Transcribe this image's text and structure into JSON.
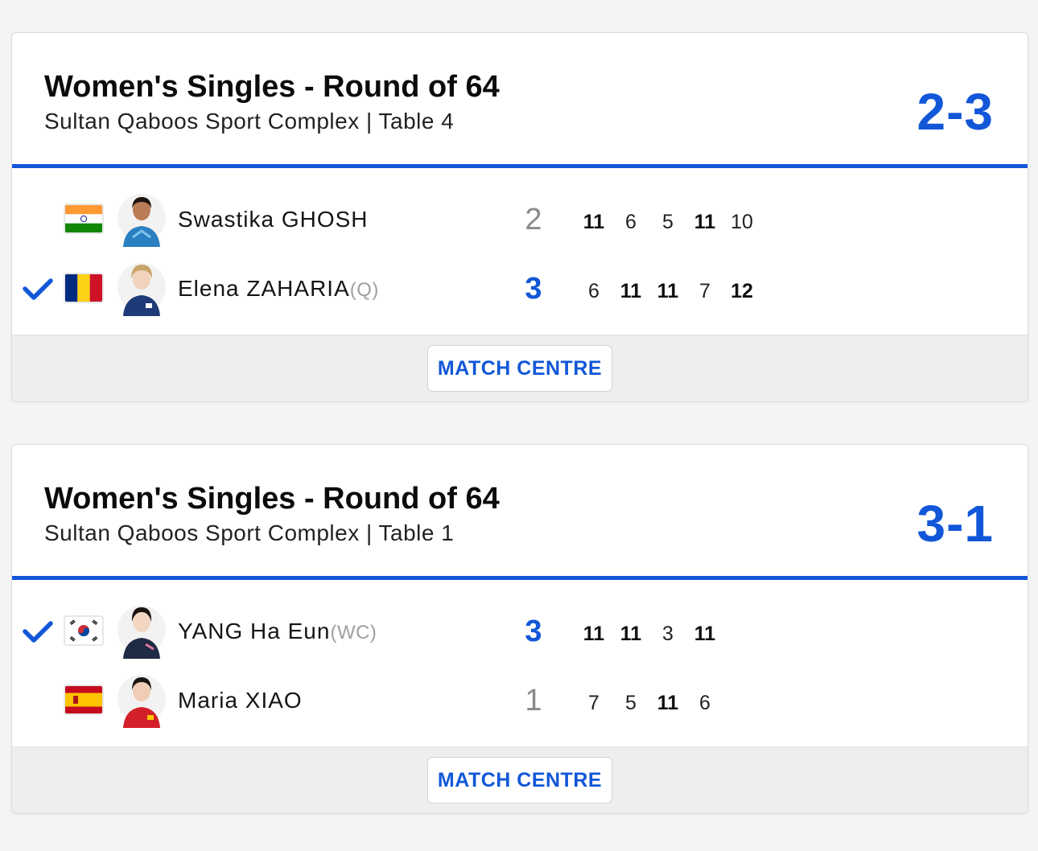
{
  "matches": [
    {
      "title": "Women's Singles - Round of 64",
      "venue": "Sultan Qaboos Sport Complex | Table 4",
      "score": "2-3",
      "button_label": "MATCH CENTRE",
      "players": [
        {
          "name": "Swastika GHOSH",
          "tag": "",
          "flag": "india-flag",
          "winner": false,
          "sets": "2",
          "games": [
            {
              "v": "11",
              "w": true
            },
            {
              "v": "6",
              "w": false
            },
            {
              "v": "5",
              "w": false
            },
            {
              "v": "11",
              "w": true
            },
            {
              "v": "10",
              "w": false
            }
          ]
        },
        {
          "name": "Elena ZAHARIA",
          "tag": "(Q)",
          "flag": "romania-flag",
          "winner": true,
          "sets": "3",
          "games": [
            {
              "v": "6",
              "w": false
            },
            {
              "v": "11",
              "w": true
            },
            {
              "v": "11",
              "w": true
            },
            {
              "v": "7",
              "w": false
            },
            {
              "v": "12",
              "w": true
            }
          ]
        }
      ]
    },
    {
      "title": "Women's Singles - Round of 64",
      "venue": "Sultan Qaboos Sport Complex | Table 1",
      "score": "3-1",
      "button_label": "MATCH CENTRE",
      "players": [
        {
          "name": "YANG Ha Eun",
          "tag": "(WC)",
          "flag": "korea-flag",
          "winner": true,
          "sets": "3",
          "games": [
            {
              "v": "11",
              "w": true
            },
            {
              "v": "11",
              "w": true
            },
            {
              "v": "3",
              "w": false
            },
            {
              "v": "11",
              "w": true
            }
          ]
        },
        {
          "name": "Maria XIAO",
          "tag": "",
          "flag": "spain-flag",
          "winner": false,
          "sets": "1",
          "games": [
            {
              "v": "7",
              "w": false
            },
            {
              "v": "5",
              "w": false
            },
            {
              "v": "11",
              "w": true
            },
            {
              "v": "6",
              "w": false
            }
          ]
        }
      ]
    }
  ],
  "colors": {
    "accent": "#1257d8",
    "footer": "#eeeeee",
    "muted": "#8a8a8a"
  }
}
